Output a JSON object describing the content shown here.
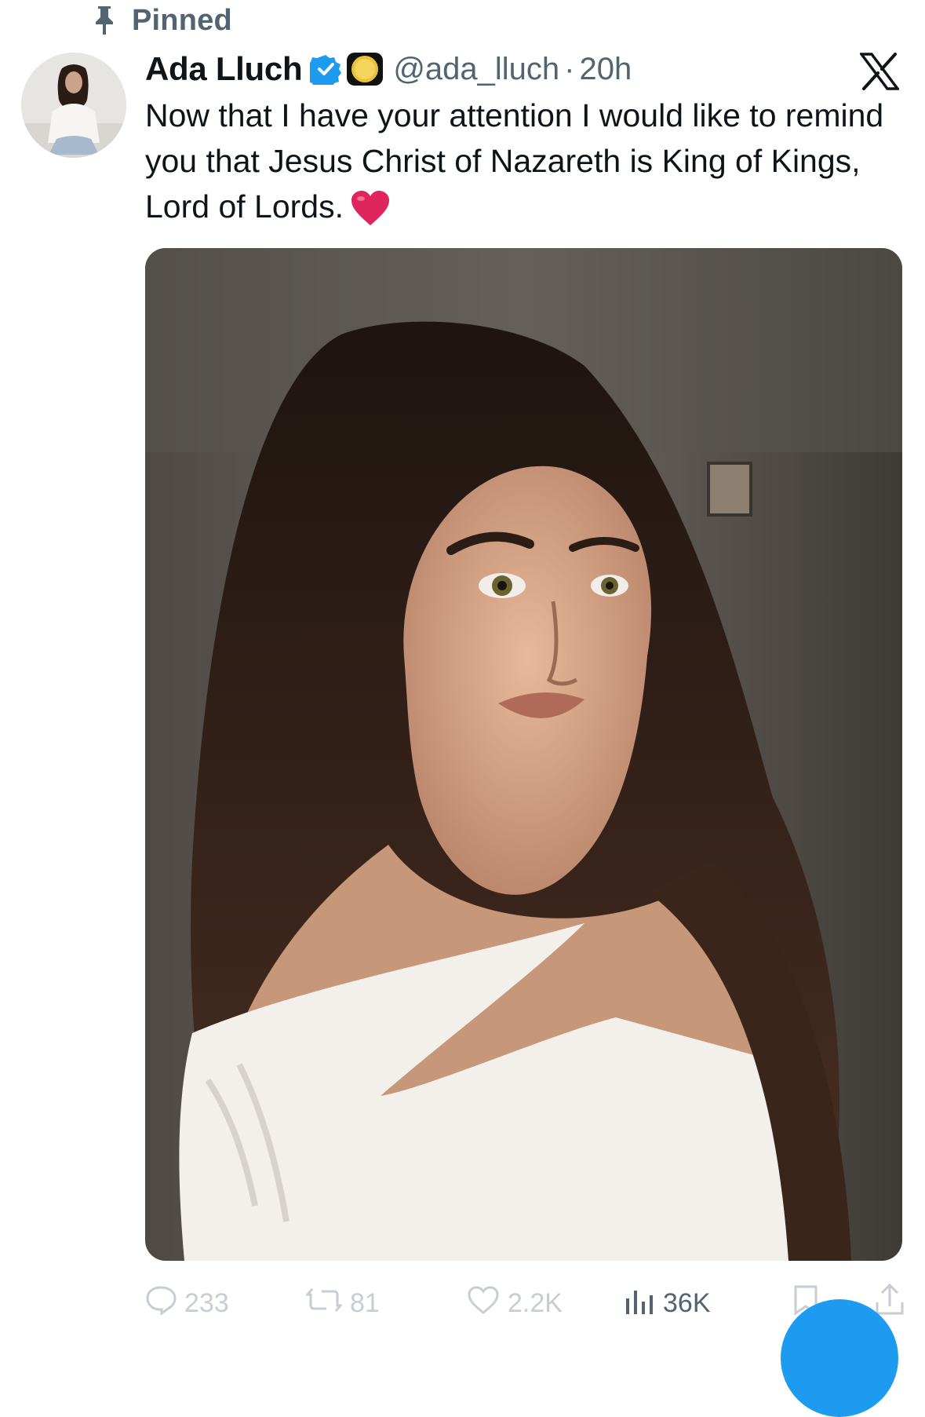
{
  "pinned": {
    "label": "Pinned",
    "icon": "pin-icon"
  },
  "author": {
    "name": "Ada Lluch",
    "handle": "@ada_lluch",
    "separator": "·",
    "time": "20h",
    "badges": [
      "verified-badge-icon",
      "gold-coin-icon"
    ]
  },
  "tweet": {
    "text": "Now that I have your attention I would like to remind you that Jesus Christ of Nazareth is King of Kings, Lord of Lords.",
    "emoji": "red-heart"
  },
  "actions": {
    "reply": "233",
    "retweet": "81",
    "like": "2.2K",
    "views": "36K"
  },
  "colors": {
    "text": "#0f1419",
    "secondary": "#536471",
    "verified": "#1d9bf0",
    "heart": "#e0245e",
    "fab": "#1d9bf0"
  }
}
